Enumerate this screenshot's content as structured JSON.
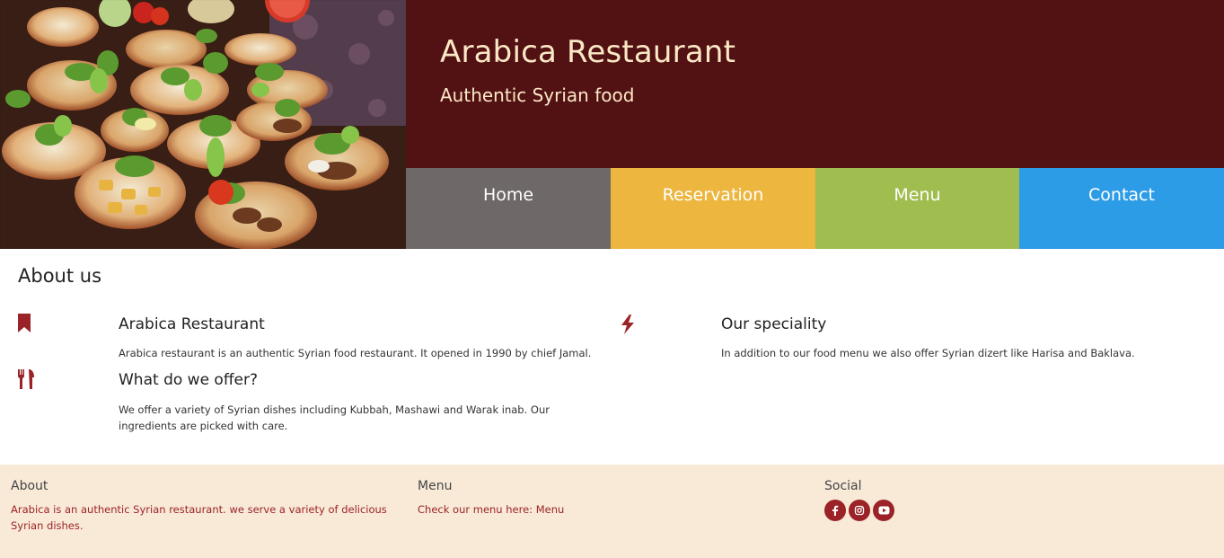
{
  "header": {
    "title": "Arabica Restaurant",
    "subtitle": "Authentic Syrian food",
    "hero_image": "mezze-dishes-photo",
    "colors": {
      "brand_bg": "#521113",
      "brand_text": "#fbe9c6"
    }
  },
  "nav": {
    "items": [
      {
        "label": "Home",
        "color": "#6e6868"
      },
      {
        "label": "Reservation",
        "color": "#ecb63f"
      },
      {
        "label": "Menu",
        "color": "#a0bd4f"
      },
      {
        "label": "Contact",
        "color": "#2d9ce6"
      }
    ]
  },
  "about": {
    "heading": "About us",
    "features": [
      {
        "icon": "bookmark-icon",
        "title": "Arabica Restaurant",
        "text": "Arabica restaurant is an authentic Syrian food restaurant. It opened in 1990 by chief Jamal."
      },
      {
        "icon": "utensils-icon",
        "title": "What do we offer?",
        "text": "We offer a variety of Syrian dishes including Kubbah, Mashawi and Warak inab. Our ingredients are picked with care."
      },
      {
        "icon": "bolt-icon",
        "title": "Our speciality",
        "text": "In addition to our food menu we also offer Syrian dizert like Harisa and Baklava."
      }
    ],
    "icon_color": "#9b2226"
  },
  "footer": {
    "about": {
      "title": "About",
      "text": "Arabica is an authentic Syrian restaurant. we serve a variety of delicious Syrian dishes."
    },
    "menu": {
      "title": "Menu",
      "text_prefix": "Check our menu here: ",
      "link": "Menu"
    },
    "social": {
      "title": "Social",
      "icons": [
        "facebook-icon",
        "instagram-icon",
        "youtube-icon"
      ]
    },
    "colors": {
      "bg": "#f9ead8",
      "accent": "#9b2226"
    }
  }
}
